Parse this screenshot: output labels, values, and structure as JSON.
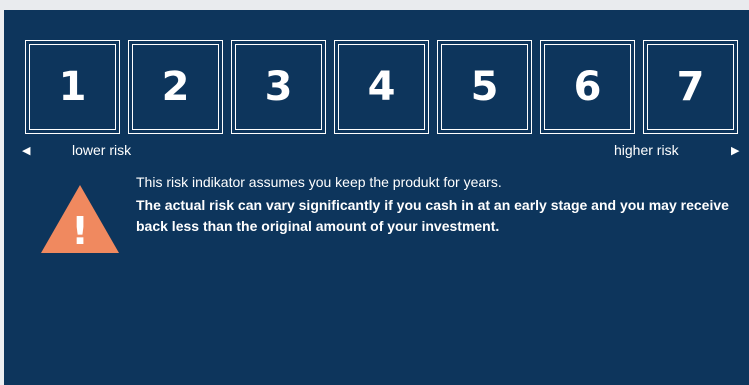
{
  "risk_scale": {
    "levels": [
      "1",
      "2",
      "3",
      "4",
      "5",
      "6",
      "7"
    ],
    "lower_label": "lower risk",
    "higher_label": "higher risk",
    "left_arrow": "◀",
    "right_arrow": "▶"
  },
  "notice": {
    "line1": "This risk indikator assumes you keep the produkt for years.",
    "line2": "The actual risk can vary significantly if you cash in at an early stage and you may receive back less than the original amount of your investment."
  },
  "icon": {
    "name": "warning-icon",
    "symbol": "!"
  },
  "colors": {
    "panel_bg": "#0d355c",
    "warning": "#f0895f",
    "text": "#ffffff"
  }
}
